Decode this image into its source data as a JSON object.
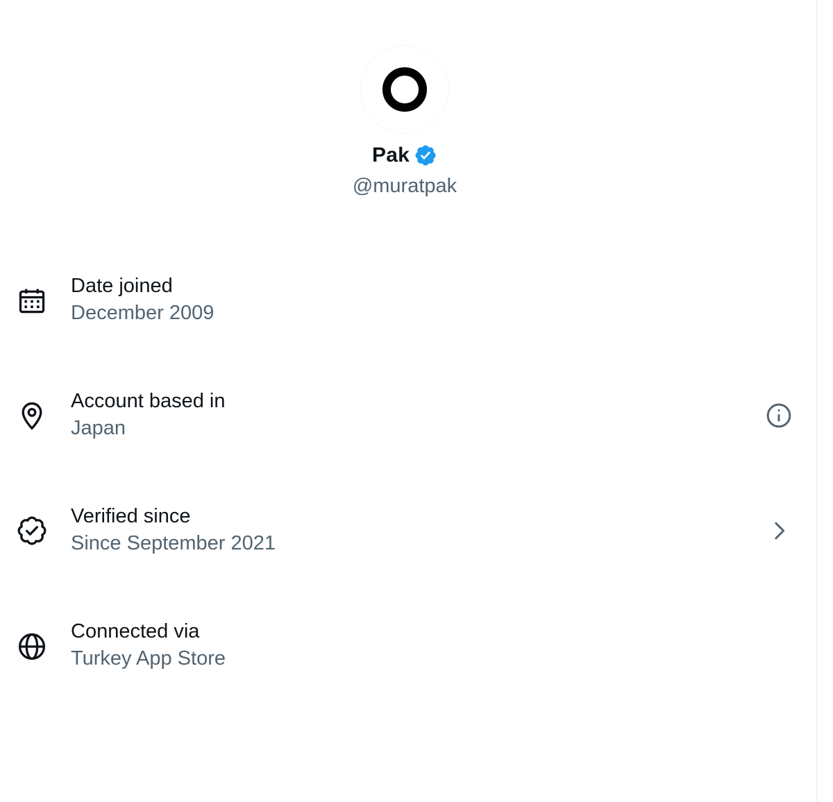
{
  "profile": {
    "name": "Pak",
    "handle": "@muratpak"
  },
  "rows": [
    {
      "label": "Date joined",
      "value": "December 2009",
      "icon": "calendar-icon"
    },
    {
      "label": "Account based in",
      "value": "Japan",
      "icon": "location-pin-icon",
      "trailing": "info-icon"
    },
    {
      "label": "Verified since",
      "value": "Since September 2021",
      "icon": "verified-badge-outline-icon",
      "trailing": "chevron-right-icon"
    },
    {
      "label": "Connected via",
      "value": "Turkey App Store",
      "icon": "globe-icon"
    }
  ],
  "colors": {
    "primary_text": "#0f1419",
    "secondary_text": "#536471",
    "verified_blue": "#1d9bf0"
  }
}
